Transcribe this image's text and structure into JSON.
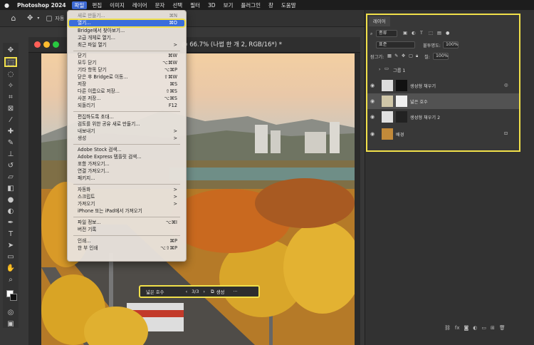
{
  "menubar": {
    "app_name": "Photoshop 2024",
    "items": [
      "파일",
      "편집",
      "이미지",
      "레이어",
      "문자",
      "선택",
      "필터",
      "3D",
      "보기",
      "플러그인",
      "창",
      "도움말"
    ]
  },
  "options_bar": {
    "auto_label": "자동"
  },
  "document": {
    "title": "@ 66.7% (나썹 한 개 2, RGB/16*) *"
  },
  "file_menu": {
    "items": [
      {
        "label": "새로 만들기...",
        "shortcut": "⌘N"
      },
      {
        "label": "열기...",
        "shortcut": "⌘O",
        "highlighted": true
      },
      {
        "label": "Bridge에서 찾아보기...",
        "shortcut": ""
      },
      {
        "label": "고급 개체로 열기...",
        "shortcut": ""
      },
      {
        "label": "최근 파일 열기",
        "shortcut": ">"
      },
      {
        "label": "닫기",
        "shortcut": "⌘W"
      },
      {
        "label": "모두 닫기",
        "shortcut": "⌥⌘W"
      },
      {
        "label": "기타 항목 닫기",
        "shortcut": "⌥⌘P"
      },
      {
        "label": "닫은 후 Bridge로 이동...",
        "shortcut": "⇧⌘W"
      },
      {
        "label": "저장",
        "shortcut": "⌘S"
      },
      {
        "label": "다른 이름으로 저장...",
        "shortcut": "⇧⌘S"
      },
      {
        "label": "사본 저장...",
        "shortcut": "⌥⌘S"
      },
      {
        "label": "되돌리기",
        "shortcut": "F12"
      },
      {
        "label": "편집하도록 초대...",
        "shortcut": ""
      },
      {
        "label": "검토를 위한 공유 새로 만들기...",
        "shortcut": ""
      },
      {
        "label": "내보내기",
        "shortcut": ">"
      },
      {
        "label": "생성",
        "shortcut": ">"
      },
      {
        "label": "Adobe Stock 검색...",
        "shortcut": ""
      },
      {
        "label": "Adobe Express 템플릿 검색...",
        "shortcut": ""
      },
      {
        "label": "포함 가져오기...",
        "shortcut": ""
      },
      {
        "label": "연결 가져오기...",
        "shortcut": ""
      },
      {
        "label": "패키지...",
        "shortcut": ""
      },
      {
        "label": "자동화",
        "shortcut": ">"
      },
      {
        "label": "스크립트",
        "shortcut": ">"
      },
      {
        "label": "가져오기",
        "shortcut": ">"
      },
      {
        "label": "iPhone 또는 iPad에서 가져오기",
        "shortcut": ""
      },
      {
        "label": "파일 정보...",
        "shortcut": "⌥⌘I"
      },
      {
        "label": "버전 기록",
        "shortcut": ""
      },
      {
        "label": "인쇄...",
        "shortcut": "⌘P"
      },
      {
        "label": "한 부 인쇄",
        "shortcut": "⌥⇧⌘P"
      }
    ]
  },
  "taskbar": {
    "label": "넓은 호수",
    "page": "3/3",
    "generate": "생성",
    "more": "···"
  },
  "layers_panel": {
    "tab": "레이어",
    "kind_label": "종류",
    "mode_label": "표준",
    "opacity_label": "불투명도:",
    "opacity_value": "100%",
    "lock_label": "잠그기:",
    "fill_label": "칠:",
    "fill_value": "100%",
    "layers": [
      {
        "name": "그룹 1",
        "type": "group"
      },
      {
        "name": "생성형 채우기",
        "type": "generative"
      },
      {
        "name": "넓은 호수",
        "type": "generative",
        "selected": true
      },
      {
        "name": "생성형 채우기 2",
        "type": "generative"
      },
      {
        "name": "배경",
        "type": "background"
      }
    ]
  },
  "colors": {
    "highlight": "#f1e04a",
    "menu_selection": "#3a6ddc"
  }
}
